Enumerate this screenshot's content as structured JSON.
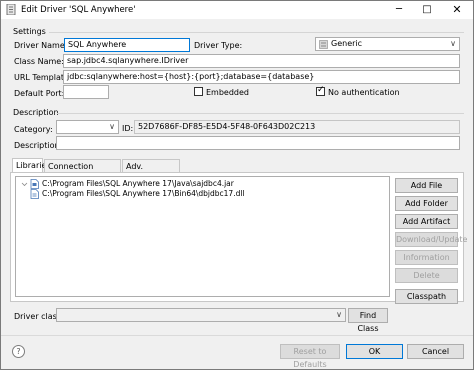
{
  "window": {
    "title": "Edit Driver 'SQL Anywhere'",
    "minimize_icon": "minimize-icon",
    "maximize_icon": "maximize-icon",
    "close_icon": "close-icon"
  },
  "settings": {
    "heading": "Settings",
    "driver_name_label": "Driver Name*:",
    "driver_name_value": "SQL Anywhere",
    "driver_type_label": "Driver Type:",
    "driver_type_value": "Generic",
    "class_name_label": "Class Name:",
    "class_name_value": "sap.jdbc4.sqlanywhere.IDriver",
    "url_template_label": "URL Template:",
    "url_template_value": "jdbc:sqlanywhere:host={host}:{port};database={database}",
    "default_port_label": "Default Port:",
    "default_port_value": "",
    "embedded_label": "Embedded",
    "embedded_checked": false,
    "no_auth_label": "No authentication",
    "no_auth_checked": true
  },
  "description": {
    "heading": "Description",
    "category_label": "Category:",
    "category_value": "",
    "id_label": "ID:",
    "id_value": "52D7686F-DF85-E5D4-5F48-0F643D02C213",
    "description_label": "Description:",
    "description_value": ""
  },
  "tabs": [
    {
      "label": "Libraries",
      "active": true
    },
    {
      "label": "Connection properties",
      "active": false
    },
    {
      "label": "Adv. parameters",
      "active": false
    }
  ],
  "libraries": [
    {
      "path": "C:\\Program Files\\SQL Anywhere 17\\Java\\sajdbc4.jar",
      "icon": "jar-file-icon"
    },
    {
      "path": "C:\\Program Files\\SQL Anywhere 17\\Bin64\\dbjdbc17.dll",
      "icon": "dll-file-icon"
    }
  ],
  "library_buttons": {
    "add_file": "Add File",
    "add_folder": "Add Folder",
    "add_artifact": "Add Artifact",
    "download_update": "Download/Update",
    "information": "Information",
    "delete": "Delete",
    "classpath": "Classpath"
  },
  "driver_class": {
    "label": "Driver class:",
    "value": "",
    "find_class": "Find Class"
  },
  "footer": {
    "help_icon": "help-icon",
    "reset": "Reset to Defaults",
    "ok": "OK",
    "cancel": "Cancel"
  }
}
